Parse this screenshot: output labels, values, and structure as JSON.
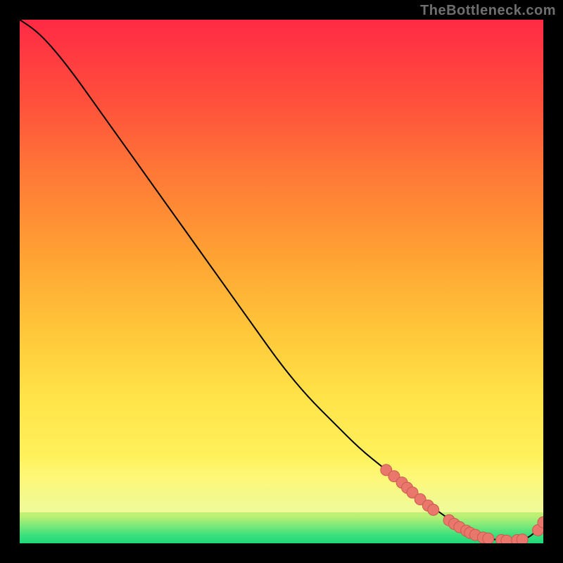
{
  "watermark": "TheBottleneck.com",
  "colors": {
    "background": "#000000",
    "curve": "#000000",
    "marker_fill": "#e9776b",
    "marker_stroke": "#c95a50"
  },
  "chart_data": {
    "type": "line",
    "title": "",
    "xlabel": "",
    "ylabel": "",
    "xlim": [
      0,
      100
    ],
    "ylim": [
      0,
      100
    ],
    "grid": false,
    "curve": {
      "x": [
        0,
        3,
        6,
        10,
        15,
        20,
        25,
        30,
        35,
        40,
        45,
        50,
        55,
        60,
        65,
        70,
        75,
        80,
        83,
        86,
        88,
        90,
        92,
        94,
        96,
        98,
        100
      ],
      "y": [
        100,
        98,
        95,
        90,
        83,
        76,
        69,
        62,
        55,
        48,
        41,
        34,
        28,
        23,
        18,
        14,
        10,
        6,
        4,
        2,
        1.2,
        0.8,
        0.6,
        0.5,
        0.6,
        1.6,
        4
      ]
    },
    "markers": [
      {
        "x": 70.0,
        "y": 14.0
      },
      {
        "x": 71.5,
        "y": 12.8
      },
      {
        "x": 73.0,
        "y": 11.6
      },
      {
        "x": 74.0,
        "y": 10.6
      },
      {
        "x": 75.0,
        "y": 9.7
      },
      {
        "x": 76.5,
        "y": 8.4
      },
      {
        "x": 78.0,
        "y": 7.2
      },
      {
        "x": 79.0,
        "y": 6.4
      },
      {
        "x": 82.0,
        "y": 4.4
      },
      {
        "x": 83.0,
        "y": 3.7
      },
      {
        "x": 84.0,
        "y": 3.1
      },
      {
        "x": 85.3,
        "y": 2.4
      },
      {
        "x": 86.0,
        "y": 2.0
      },
      {
        "x": 87.0,
        "y": 1.6
      },
      {
        "x": 88.5,
        "y": 1.1
      },
      {
        "x": 89.5,
        "y": 0.9
      },
      {
        "x": 92.0,
        "y": 0.6
      },
      {
        "x": 93.0,
        "y": 0.5
      },
      {
        "x": 95.0,
        "y": 0.6
      },
      {
        "x": 96.0,
        "y": 0.7
      },
      {
        "x": 99.0,
        "y": 2.5
      },
      {
        "x": 100.0,
        "y": 4.0
      }
    ]
  }
}
